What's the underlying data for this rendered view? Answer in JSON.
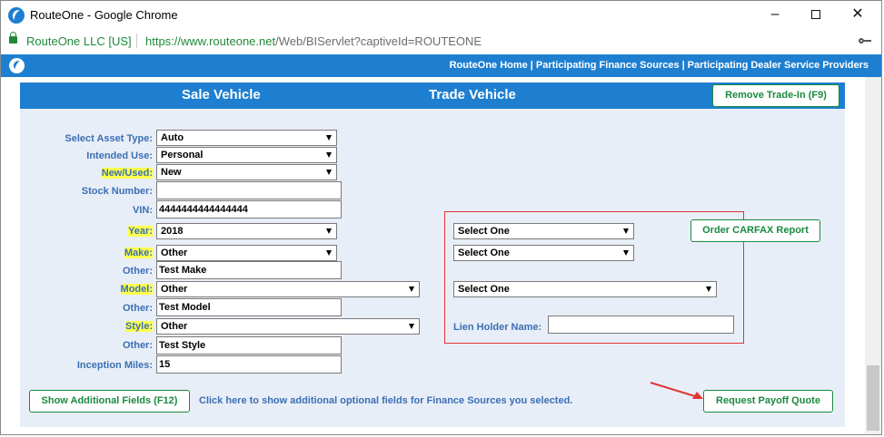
{
  "window": {
    "title": "RouteOne - Google Chrome"
  },
  "addressbar": {
    "site_identity": "RouteOne LLC [US]",
    "url_scheme": "https://",
    "url_host": "www.routeone.net",
    "url_path": "/Web/BIServlet?captiveId=ROUTEONE"
  },
  "header": {
    "nav": [
      "RouteOne Home",
      "Participating Finance Sources",
      "Participating Dealer Service Providers"
    ],
    "separator": "|"
  },
  "tabs": {
    "sale": "Sale Vehicle",
    "trade": "Trade Vehicle"
  },
  "buttons": {
    "remove_trade": "Remove Trade-In (F9)",
    "order_carfax": "Order CARFAX Report",
    "show_additional": "Show Additional Fields (F12)",
    "request_payoff": "Request Payoff Quote"
  },
  "helper_text": "Click here to show additional optional fields for Finance Sources you selected.",
  "form": {
    "asset_type": {
      "label": "Select Asset Type:",
      "value": "Auto"
    },
    "intended_use": {
      "label": "Intended Use:",
      "value": "Personal"
    },
    "new_used": {
      "label": "New/Used:",
      "value": "New"
    },
    "stock_number": {
      "label": "Stock Number:",
      "value": ""
    },
    "vin": {
      "label": "VIN:",
      "value": "4444444444444444"
    },
    "year": {
      "label": "Year:",
      "value": "2018"
    },
    "make": {
      "label": "Make:",
      "value": "Other"
    },
    "make_other": {
      "label": "Other:",
      "value": "Test Make"
    },
    "model": {
      "label": "Model:",
      "value": "Other"
    },
    "model_other": {
      "label": "Other:",
      "value": "Test Model"
    },
    "style": {
      "label": "Style:",
      "value": "Other"
    },
    "style_other": {
      "label": "Other:",
      "value": "Test Style"
    },
    "inception_miles": {
      "label": "Inception Miles:",
      "value": "15"
    }
  },
  "trade": {
    "select1": "Select One",
    "select2": "Select One",
    "select3": "Select One",
    "lien_label": "Lien Holder Name:",
    "lien_value": ""
  },
  "colors": {
    "brand": "#1e7fd0",
    "label": "#3a6fb5",
    "button": "#1a8a3e",
    "highlight": "#ffff4d",
    "annotation": "#e03434"
  }
}
